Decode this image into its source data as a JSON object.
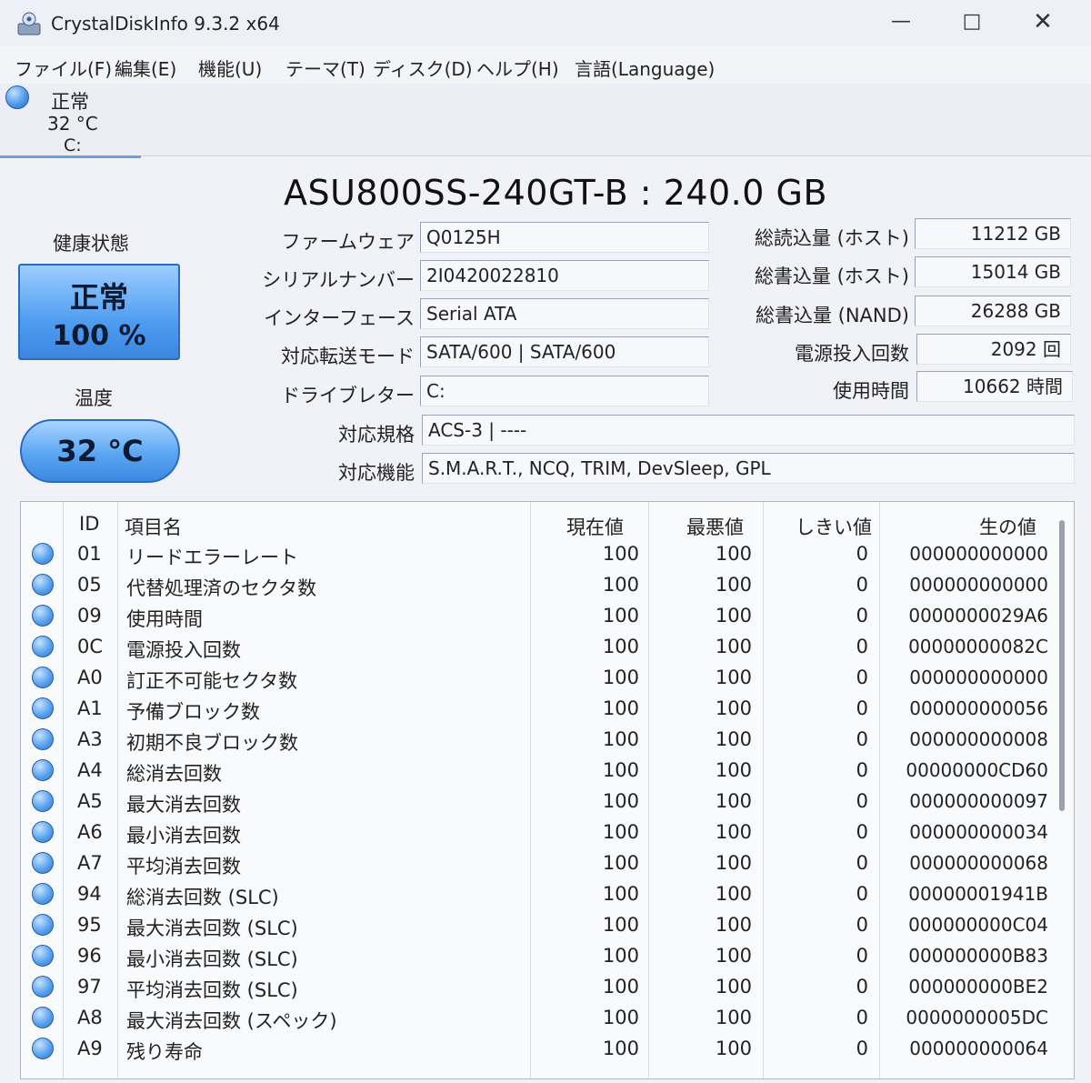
{
  "app": {
    "title": "CrystalDiskInfo 9.3.2 x64"
  },
  "menu": [
    "ファイル(F)",
    "編集(E)",
    "機能(U)",
    "テーマ(T)",
    "ディスク(D)",
    "ヘルプ(H)",
    "言語(Language)"
  ],
  "drive_tab": {
    "status": "正常",
    "temp": "32 °C",
    "letter": "C:"
  },
  "model": "ASU800SS-240GT-B : 240.0 GB",
  "health": {
    "label": "健康状態",
    "status": "正常",
    "percent": "100 %"
  },
  "temperature": {
    "label": "温度",
    "value": "32 °C"
  },
  "info_left": [
    {
      "label": "ファームウェア",
      "value": "Q0125H"
    },
    {
      "label": "シリアルナンバー",
      "value": "2I0420022810"
    },
    {
      "label": "インターフェース",
      "value": "Serial ATA"
    },
    {
      "label": "対応転送モード",
      "value": "SATA/600 | SATA/600"
    },
    {
      "label": "ドライブレター",
      "value": "C:"
    }
  ],
  "info_right": [
    {
      "label": "総読込量 (ホスト)",
      "value": "11212 GB"
    },
    {
      "label": "総書込量 (ホスト)",
      "value": "15014 GB"
    },
    {
      "label": "総書込量 (NAND)",
      "value": "26288 GB"
    },
    {
      "label": "電源投入回数",
      "value": "2092 回"
    },
    {
      "label": "使用時間",
      "value": "10662 時間"
    }
  ],
  "standard": {
    "label": "対応規格",
    "value": "ACS-3 | ----"
  },
  "features": {
    "label": "対応機能",
    "value": "S.M.A.R.T., NCQ, TRIM, DevSleep, GPL"
  },
  "smart_headers": {
    "id": "ID",
    "name": "項目名",
    "current": "現在値",
    "worst": "最悪値",
    "threshold": "しきい値",
    "raw": "生の値"
  },
  "smart_rows": [
    {
      "id": "01",
      "name": "リードエラーレート",
      "current": "100",
      "worst": "100",
      "threshold": "0",
      "raw": "000000000000"
    },
    {
      "id": "05",
      "name": "代替処理済のセクタ数",
      "current": "100",
      "worst": "100",
      "threshold": "0",
      "raw": "000000000000"
    },
    {
      "id": "09",
      "name": "使用時間",
      "current": "100",
      "worst": "100",
      "threshold": "0",
      "raw": "0000000029A6"
    },
    {
      "id": "0C",
      "name": "電源投入回数",
      "current": "100",
      "worst": "100",
      "threshold": "0",
      "raw": "00000000082C"
    },
    {
      "id": "A0",
      "name": "訂正不可能セクタ数",
      "current": "100",
      "worst": "100",
      "threshold": "0",
      "raw": "000000000000"
    },
    {
      "id": "A1",
      "name": "予備ブロック数",
      "current": "100",
      "worst": "100",
      "threshold": "0",
      "raw": "000000000056"
    },
    {
      "id": "A3",
      "name": "初期不良ブロック数",
      "current": "100",
      "worst": "100",
      "threshold": "0",
      "raw": "000000000008"
    },
    {
      "id": "A4",
      "name": "総消去回数",
      "current": "100",
      "worst": "100",
      "threshold": "0",
      "raw": "00000000CD60"
    },
    {
      "id": "A5",
      "name": "最大消去回数",
      "current": "100",
      "worst": "100",
      "threshold": "0",
      "raw": "000000000097"
    },
    {
      "id": "A6",
      "name": "最小消去回数",
      "current": "100",
      "worst": "100",
      "threshold": "0",
      "raw": "000000000034"
    },
    {
      "id": "A7",
      "name": "平均消去回数",
      "current": "100",
      "worst": "100",
      "threshold": "0",
      "raw": "000000000068"
    },
    {
      "id": "94",
      "name": "総消去回数 (SLC)",
      "current": "100",
      "worst": "100",
      "threshold": "0",
      "raw": "00000001941B"
    },
    {
      "id": "95",
      "name": "最大消去回数 (SLC)",
      "current": "100",
      "worst": "100",
      "threshold": "0",
      "raw": "000000000C04"
    },
    {
      "id": "96",
      "name": "最小消去回数 (SLC)",
      "current": "100",
      "worst": "100",
      "threshold": "0",
      "raw": "000000000B83"
    },
    {
      "id": "97",
      "name": "平均消去回数 (SLC)",
      "current": "100",
      "worst": "100",
      "threshold": "0",
      "raw": "000000000BE2"
    },
    {
      "id": "A8",
      "name": "最大消去回数 (スペック)",
      "current": "100",
      "worst": "100",
      "threshold": "0",
      "raw": "0000000005DC"
    },
    {
      "id": "A9",
      "name": "残り寿命",
      "current": "100",
      "worst": "100",
      "threshold": "0",
      "raw": "000000000064"
    }
  ]
}
